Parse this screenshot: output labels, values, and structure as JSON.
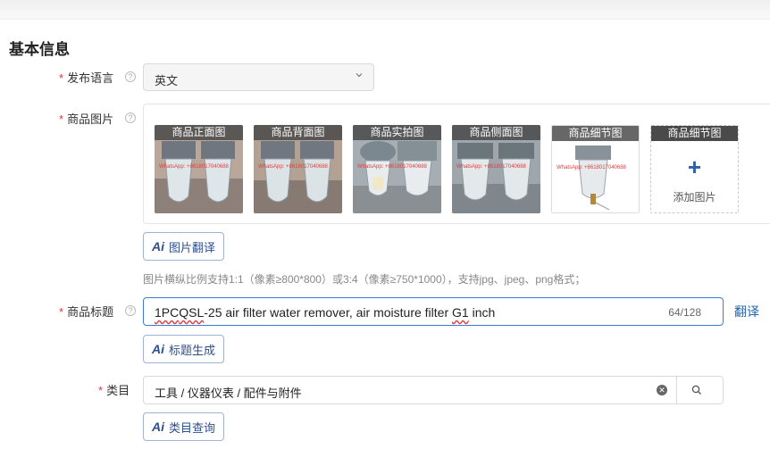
{
  "section_title": "基本信息",
  "language": {
    "label": "发布语言",
    "value": "英文"
  },
  "images": {
    "label": "商品图片",
    "thumbs": [
      {
        "caption": "商品正面图",
        "watermark": "WhatsApp: +8618017040688"
      },
      {
        "caption": "商品背面图",
        "watermark": "WhatsApp: +8618017040688"
      },
      {
        "caption": "商品实拍图",
        "watermark": "WhatsApp: +8618017040688"
      },
      {
        "caption": "商品侧面图",
        "watermark": "WhatsApp: +8618017040688"
      },
      {
        "caption": "商品细节图",
        "watermark": "WhatsApp: +8618017040688"
      }
    ],
    "add_caption": "商品细节图",
    "add_label": "添加图片",
    "ai_button": "图片翻译",
    "hint": "图片横纵比例支持1:1（像素≥800*800）或3:4（像素≥750*1000），支持jpg、jpeg、png格式；"
  },
  "title": {
    "label": "商品标题",
    "value_part1": "1PC",
    "value_part2": "QSL",
    "value_part3": "-25 air filter water remover, air moisture filter ",
    "value_part4": "G1",
    "value_part5": " inch",
    "count": "64/128",
    "translate": "翻译",
    "ai_button": "标题生成"
  },
  "category": {
    "label": "类目",
    "value": "工具 / 仪器仪表 / 配件与附件",
    "ai_button": "类目查询"
  },
  "ai_icon_text": "Ai",
  "colors": {
    "accent": "#2e4f8f",
    "link": "#1c64b5",
    "required": "#e4393c",
    "focus_border": "#3a7bd5"
  }
}
